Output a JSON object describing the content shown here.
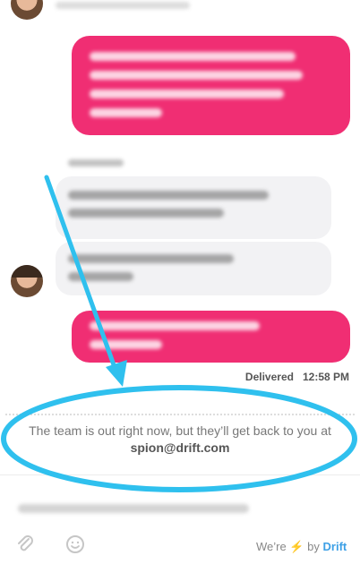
{
  "conversation": {
    "delivered": {
      "status": "Delivered",
      "time": "12:58 PM"
    },
    "notice": {
      "text": "The team is out right now, but they’ll get back to you at",
      "email": "spion@drift.com"
    }
  },
  "footer": {
    "powered_prefix": "We’re",
    "powered_by": "by",
    "brand": "Drift"
  },
  "colors": {
    "user_bubble": "#f02e73",
    "agent_bubble": "#f2f2f4",
    "annotation": "#2fc0ee",
    "brand": "#3da0e6"
  },
  "icons": [
    "paperclip-icon",
    "smiley-icon",
    "lightning-icon",
    "arrow-annotation",
    "ellipse-annotation"
  ]
}
